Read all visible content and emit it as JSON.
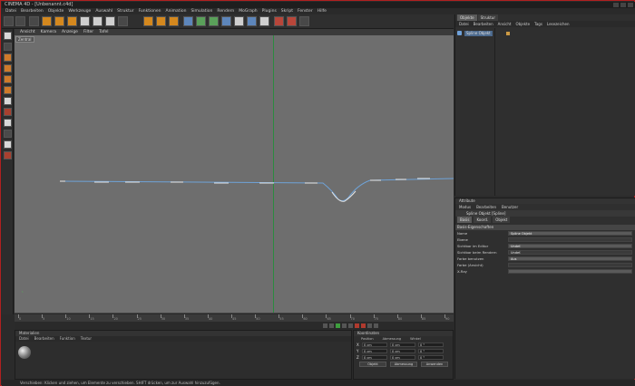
{
  "window": {
    "title": "CINEMA 4D - [Unbenannt.c4d]"
  },
  "menubar": [
    "Datei",
    "Bearbeiten",
    "Objekte",
    "Werkzeuge",
    "Auswahl",
    "Struktur",
    "Funktionen",
    "Animation",
    "Simulation",
    "Rendern",
    "MoGraph",
    "Plugins",
    "Skript",
    "Fenster",
    "Hilfe"
  ],
  "viewport": {
    "menu": [
      "Ansicht",
      "Kamera",
      "Anzeige",
      "Filter",
      "Tafel"
    ],
    "tag": "Zentral"
  },
  "timeline": {
    "ticks": [
      "0",
      "5",
      "10",
      "15",
      "20",
      "25",
      "30",
      "35",
      "40",
      "45",
      "50",
      "55",
      "60",
      "65",
      "70",
      "75",
      "80",
      "85",
      "90"
    ]
  },
  "material_panel": {
    "title": "Materialien",
    "menu": [
      "Datei",
      "Bearbeiten",
      "Funktion",
      "Textur"
    ]
  },
  "coord_panel": {
    "title": "Koordinaten",
    "headers": [
      "Position",
      "Abmessung",
      "Winkel"
    ],
    "rows": [
      {
        "axis": "X",
        "pos": "0 cm",
        "size": "0 cm",
        "angle": "0 °"
      },
      {
        "axis": "Y",
        "pos": "0 cm",
        "size": "0 cm",
        "angle": "0 °"
      },
      {
        "axis": "Z",
        "pos": "0 cm",
        "size": "0 cm",
        "angle": "0 °"
      }
    ],
    "buttons": [
      "Objekt",
      "Abmessung",
      "Anwenden"
    ]
  },
  "object_panel": {
    "tabs": [
      "Objekte",
      "Struktur"
    ],
    "menu": [
      "Datei",
      "Bearbeiten",
      "Ansicht",
      "Objekte",
      "Tags",
      "Lesezeichen"
    ],
    "item": "Spline Objekt"
  },
  "attr_panel": {
    "title": "Attribute",
    "menu": [
      "Modus",
      "Bearbeiten",
      "Benutzer"
    ],
    "object_title": "Spline Objekt [Spline]",
    "tabs": [
      "Basis",
      "Koord.",
      "Objekt"
    ],
    "section": "Basis-Eigenschaften",
    "props": [
      {
        "label": "Name",
        "value": "Spline Objekt"
      },
      {
        "label": "Ebene",
        "value": ""
      },
      {
        "label": "Sichtbar im Editor",
        "value": "Undef."
      },
      {
        "label": "Sichtbar beim Rendern",
        "value": "Undef."
      },
      {
        "label": "Farbe benutzen",
        "value": "Aus"
      },
      {
        "label": "Farbe (Ansicht)",
        "value": ""
      },
      {
        "label": "X-Ray",
        "value": ""
      }
    ]
  },
  "statusbar": {
    "text": "Verschieben: Klicken und ziehen, um Elemente zu verschieben. SHIFT drücken, um zur Auswahl hinzuzufügen."
  },
  "colors": {
    "viewport_bg": "#6e6e6e",
    "axis_green": "#2b8a3f",
    "spline_blue": "#6fa3d8"
  }
}
